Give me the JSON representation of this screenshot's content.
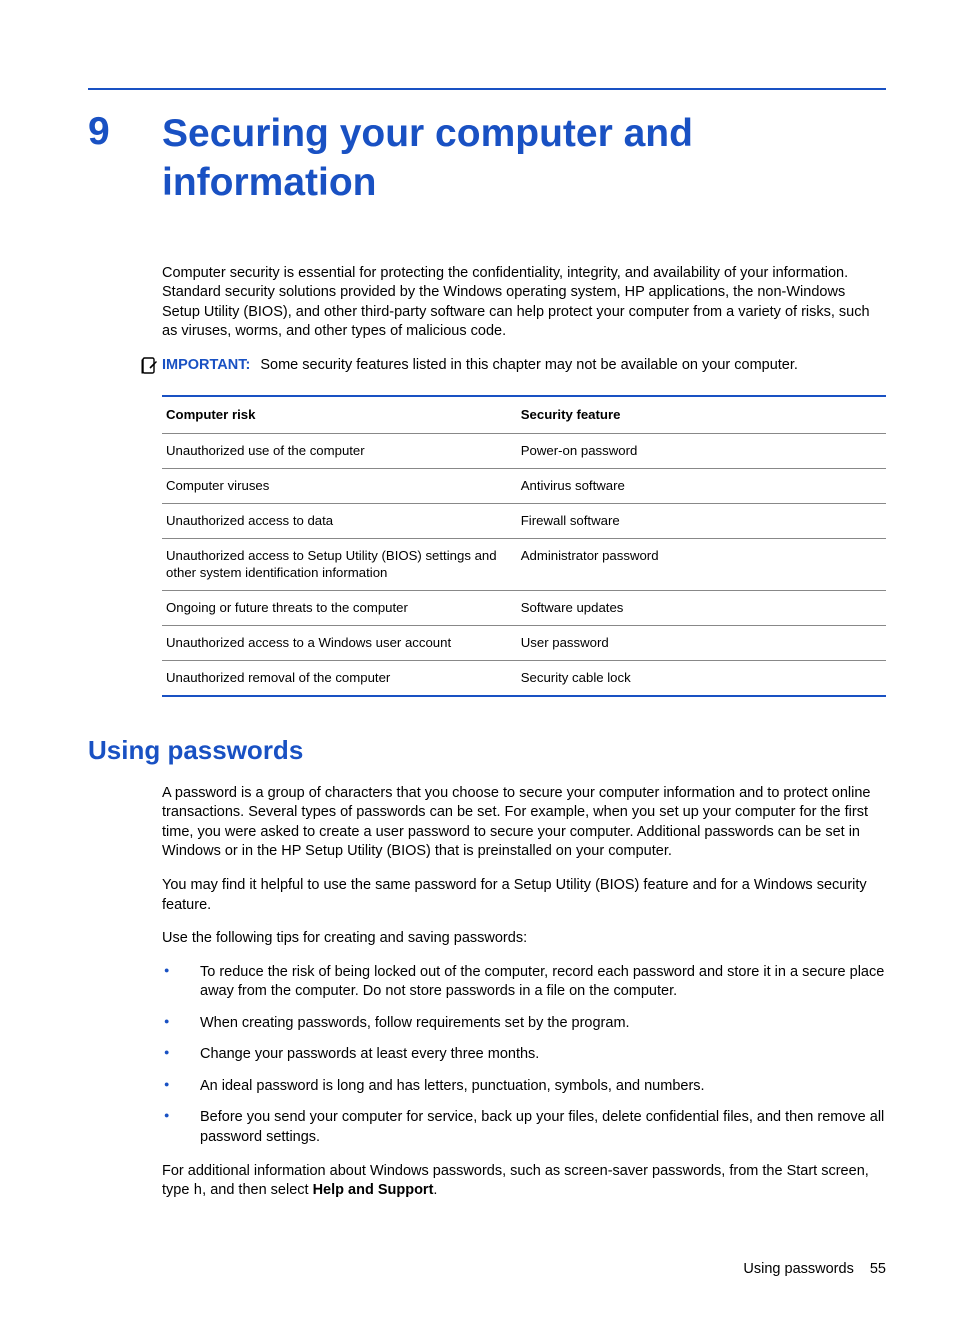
{
  "chapter": {
    "number": "9",
    "title": "Securing your computer and information"
  },
  "intro_paragraph": "Computer security is essential for protecting the confidentiality, integrity, and availability of your information. Standard security solutions provided by the Windows operating system, HP applications, the non-Windows Setup Utility (BIOS), and other third-party software can help protect your computer from a variety of risks, such as viruses, worms, and other types of malicious code.",
  "important_note": {
    "label": "IMPORTANT:",
    "text": "Some security features listed in this chapter may not be available on your computer."
  },
  "risk_table": {
    "headers": {
      "risk": "Computer risk",
      "feature": "Security feature"
    },
    "rows": [
      {
        "risk": "Unauthorized use of the computer",
        "feature": "Power-on password"
      },
      {
        "risk": "Computer viruses",
        "feature": "Antivirus software"
      },
      {
        "risk": "Unauthorized access to data",
        "feature": "Firewall software"
      },
      {
        "risk": "Unauthorized access to Setup Utility (BIOS) settings and other system identification information",
        "feature": "Administrator password"
      },
      {
        "risk": "Ongoing or future threats to the computer",
        "feature": "Software updates"
      },
      {
        "risk": "Unauthorized access to a Windows user account",
        "feature": "User password"
      },
      {
        "risk": "Unauthorized removal of the computer",
        "feature": "Security cable lock"
      }
    ]
  },
  "section": {
    "heading": "Using passwords",
    "p1": "A password is a group of characters that you choose to secure your computer information and to protect online transactions. Several types of passwords can be set. For example, when you set up your computer for the first time, you were asked to create a user password to secure your computer. Additional passwords can be set in Windows or in the HP Setup Utility (BIOS) that is preinstalled on your computer.",
    "p2": "You may find it helpful to use the same password for a Setup Utility (BIOS) feature and for a Windows security feature.",
    "p3": "Use the following tips for creating and saving passwords:",
    "bullets": [
      "To reduce the risk of being locked out of the computer, record each password and store it in a secure place away from the computer. Do not store passwords in a file on the computer.",
      "When creating passwords, follow requirements set by the program.",
      "Change your passwords at least every three months.",
      "An ideal password is long and has letters, punctuation, symbols, and numbers.",
      "Before you send your computer for service, back up your files, delete confidential files, and then remove all password settings."
    ],
    "p4_prefix": "For additional information about Windows passwords, such as screen-saver passwords, from the Start screen, type ",
    "p4_code": "h",
    "p4_mid": ", and then select ",
    "p4_bold": "Help and Support",
    "p4_suffix": "."
  },
  "footer": {
    "label": "Using passwords",
    "page": "55"
  }
}
